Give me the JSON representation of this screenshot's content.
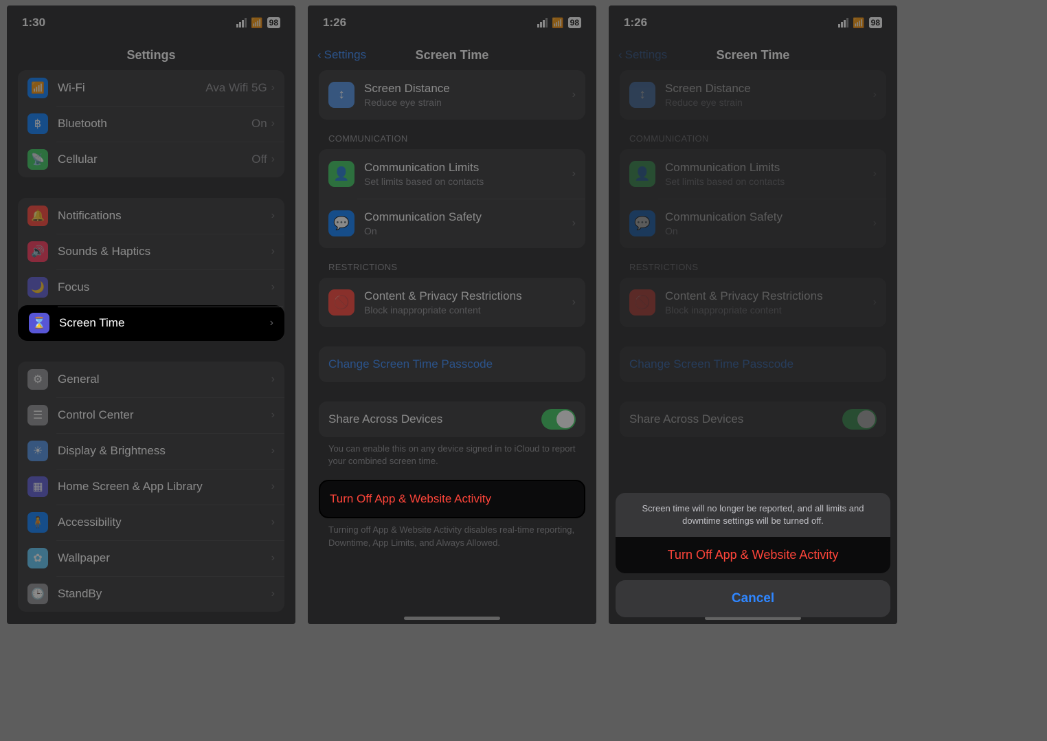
{
  "panel1": {
    "status": {
      "time": "1:30",
      "battery": "98"
    },
    "header": {
      "title": "Settings"
    },
    "groups": [
      {
        "rows": [
          {
            "icon": "wifi-icon",
            "color": "c-blue",
            "title": "Wi-Fi",
            "detail": "Ava Wifi 5G"
          },
          {
            "icon": "bluetooth-icon",
            "color": "c-blue",
            "title": "Bluetooth",
            "detail": "On"
          },
          {
            "icon": "antenna-icon",
            "color": "c-green",
            "title": "Cellular",
            "detail": "Off"
          }
        ]
      },
      {
        "rows": [
          {
            "icon": "bell-icon",
            "color": "c-red",
            "title": "Notifications"
          },
          {
            "icon": "speaker-icon",
            "color": "c-rose",
            "title": "Sounds & Haptics"
          },
          {
            "icon": "moon-icon",
            "color": "c-indigo",
            "title": "Focus"
          },
          {
            "icon": "hourglass-icon",
            "color": "c-indigo",
            "title": "Screen Time",
            "highlight": true
          }
        ]
      },
      {
        "rows": [
          {
            "icon": "gear-icon",
            "color": "c-grey",
            "title": "General"
          },
          {
            "icon": "switches-icon",
            "color": "c-grey",
            "title": "Control Center"
          },
          {
            "icon": "sun-icon",
            "color": "c-pblue",
            "title": "Display & Brightness"
          },
          {
            "icon": "grid-icon",
            "color": "c-indigo",
            "title": "Home Screen & App Library"
          },
          {
            "icon": "person-icon",
            "color": "c-blue",
            "title": "Accessibility"
          },
          {
            "icon": "flower-icon",
            "color": "c-teal",
            "title": "Wallpaper"
          },
          {
            "icon": "clock-icon",
            "color": "c-grey",
            "title": "StandBy"
          }
        ]
      }
    ]
  },
  "panel2": {
    "status": {
      "time": "1:26",
      "battery": "98"
    },
    "header": {
      "back": "Settings",
      "title": "Screen Time"
    },
    "screenDistance": {
      "title": "Screen Distance",
      "sub": "Reduce eye strain"
    },
    "sections": {
      "communication_label": "COMMUNICATION",
      "comm_limits": {
        "title": "Communication Limits",
        "sub": "Set limits based on contacts"
      },
      "comm_safety": {
        "title": "Communication Safety",
        "sub": "On"
      },
      "restrictions_label": "RESTRICTIONS",
      "content_privacy": {
        "title": "Content & Privacy Restrictions",
        "sub": "Block inappropriate content"
      },
      "change_passcode": "Change Screen Time Passcode",
      "share_devices": "Share Across Devices",
      "share_footer": "You can enable this on any device signed in to iCloud to report your combined screen time.",
      "turn_off": "Turn Off App & Website Activity",
      "turn_off_footer": "Turning off App & Website Activity disables real-time reporting, Downtime, App Limits, and Always Allowed."
    }
  },
  "panel3": {
    "status": {
      "time": "1:26",
      "battery": "98"
    },
    "header": {
      "back": "Settings",
      "title": "Screen Time"
    },
    "sheet": {
      "message": "Screen time will no longer be reported, and all limits and downtime settings will be turned off.",
      "action": "Turn Off App & Website Activity",
      "cancel": "Cancel"
    }
  }
}
